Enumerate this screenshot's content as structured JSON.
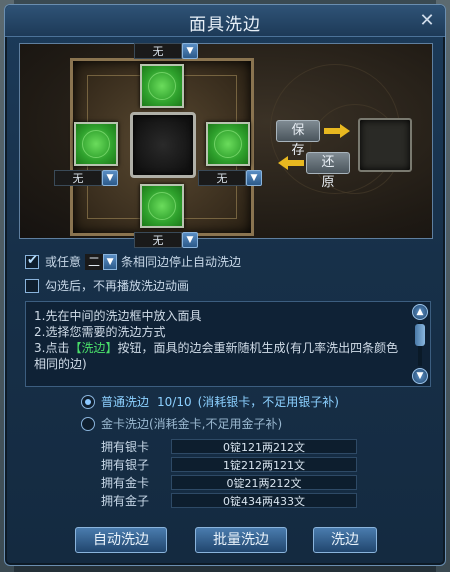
{
  "window": {
    "title": "面具洗边"
  },
  "preview": {
    "slot_top_value": "无",
    "slot_left_value": "无",
    "slot_right_value": "无",
    "slot_bottom_value": "无",
    "save_label": "保存",
    "restore_label": "还原"
  },
  "options": {
    "any_label": "或任意",
    "count_value": "二",
    "stop_label": "条相同边停止自动洗边",
    "skip_anim_label": "勾选后，不再播放洗边动画",
    "any_checked": true,
    "skip_anim_checked": false
  },
  "instructions": {
    "line1": "1.先在中间的洗边框中放入面具",
    "line2": "2.选择您需要的洗边方式",
    "line3_pre": "3.点击",
    "line3_hl": "【洗边】",
    "line3_post": "按钮，面具的边会重新随机生成(有几率洗出四条颜色相同的边)"
  },
  "methods": {
    "normal_label": "普通洗边",
    "normal_count": "10/10",
    "normal_note": "(消耗银卡，不足用银子补)",
    "gold_label": "金卡洗边(消耗金卡,不足用金子补)",
    "selected": "normal"
  },
  "resources": [
    {
      "label": "拥有银卡",
      "value": "0锭121两212文"
    },
    {
      "label": "拥有银子",
      "value": "1锭212两121文"
    },
    {
      "label": "拥有金卡",
      "value": "0锭21两212文"
    },
    {
      "label": "拥有金子",
      "value": "0锭434两433文"
    }
  ],
  "buttons": {
    "auto": "自动洗边",
    "batch": "批量洗边",
    "wash": "洗边"
  },
  "colors": {
    "accent": "#4a7cae",
    "highlight_green": "#4ae06a",
    "title_bg": "#2f5377"
  }
}
